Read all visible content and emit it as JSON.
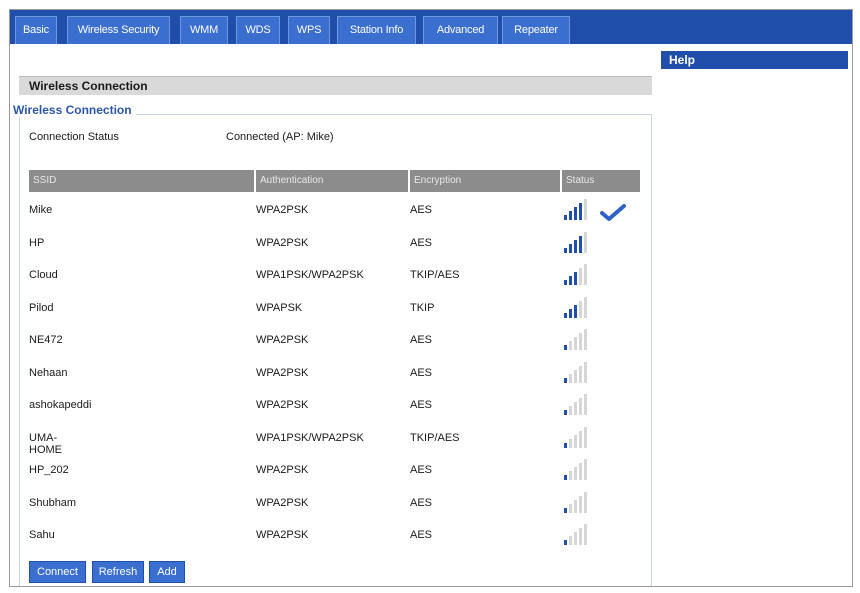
{
  "tabs": [
    {
      "label": "Basic"
    },
    {
      "label": "Wireless Security"
    },
    {
      "label": "WMM"
    },
    {
      "label": "WDS"
    },
    {
      "label": "WPS"
    },
    {
      "label": "Station Info"
    },
    {
      "label": "Advanced"
    },
    {
      "label": "Repeater"
    }
  ],
  "section": {
    "header": "Wireless Connection",
    "legend": "Wireless Connection",
    "status_label": "Connection Status",
    "status_value": "Connected (AP: Mike)"
  },
  "help": {
    "title": "Help"
  },
  "table": {
    "columns": [
      "SSID",
      "Authentication",
      "Encryption",
      "Status"
    ],
    "rows": [
      {
        "ssid": "Mike",
        "auth": "WPA2PSK",
        "enc": "AES",
        "signal": 4,
        "connected": true
      },
      {
        "ssid": "HP",
        "auth": "WPA2PSK",
        "enc": "AES",
        "signal": 4,
        "connected": false
      },
      {
        "ssid": "Cloud",
        "auth": "WPA1PSK/WPA2PSK",
        "enc": "TKIP/AES",
        "signal": 3,
        "connected": false
      },
      {
        "ssid": "Pilod",
        "auth": "WPAPSK",
        "enc": "TKIP",
        "signal": 3,
        "connected": false
      },
      {
        "ssid": "NE472",
        "auth": "WPA2PSK",
        "enc": "AES",
        "signal": 1,
        "connected": false
      },
      {
        "ssid": "Nehaan",
        "auth": "WPA2PSK",
        "enc": "AES",
        "signal": 1,
        "connected": false
      },
      {
        "ssid": "ashokapeddi",
        "auth": "WPA2PSK",
        "enc": "AES",
        "signal": 1,
        "connected": false
      },
      {
        "ssid": "UMA-HOME",
        "auth": "WPA1PSK/WPA2PSK",
        "enc": "TKIP/AES",
        "signal": 1,
        "connected": false
      },
      {
        "ssid": "HP_202",
        "auth": "WPA2PSK",
        "enc": "AES",
        "signal": 1,
        "connected": false
      },
      {
        "ssid": "Shubham",
        "auth": "WPA2PSK",
        "enc": "AES",
        "signal": 1,
        "connected": false
      },
      {
        "ssid": "Sahu",
        "auth": "WPA2PSK",
        "enc": "AES",
        "signal": 1,
        "connected": false
      }
    ]
  },
  "buttons": {
    "connect": "Connect",
    "refresh": "Refresh",
    "add": "Add"
  },
  "icons": {
    "signal": "wifi-signal-icon",
    "connected": "checkmark-icon"
  },
  "colors": {
    "nav": "#1f4faa",
    "tab": "#3a6fd0",
    "header_gray": "#d9d9d9",
    "column_header": "#8c8c8c",
    "signal_active": "#1f4faa",
    "signal_inactive": "#d6d6d6"
  }
}
